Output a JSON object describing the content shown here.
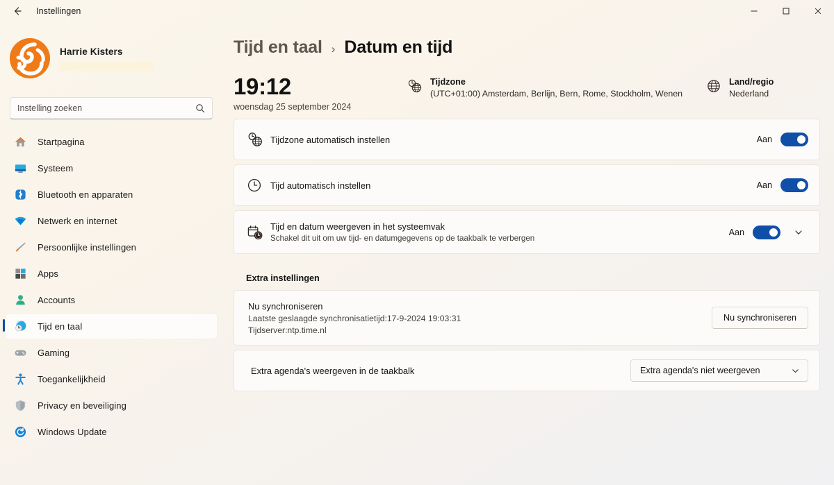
{
  "window": {
    "title": "Instellingen",
    "back_icon": "back-arrow-icon",
    "minimize_label": "–",
    "maximize_label": "□",
    "close_label": "✕"
  },
  "sidebar": {
    "profile": {
      "name": "Harrie Kisters",
      "email_redacted": true
    },
    "search": {
      "placeholder": "Instelling zoeken",
      "value": "",
      "icon": "search-icon"
    },
    "items": [
      {
        "label": "Startpagina",
        "icon": "home-icon",
        "selected": false
      },
      {
        "label": "Systeem",
        "icon": "monitor-icon",
        "selected": false
      },
      {
        "label": "Bluetooth en apparaten",
        "icon": "bluetooth-icon",
        "selected": false
      },
      {
        "label": "Netwerk en internet",
        "icon": "wifi-icon",
        "selected": false
      },
      {
        "label": "Persoonlijke instellingen",
        "icon": "paintbrush-icon",
        "selected": false
      },
      {
        "label": "Apps",
        "icon": "apps-icon",
        "selected": false
      },
      {
        "label": "Accounts",
        "icon": "person-icon",
        "selected": false
      },
      {
        "label": "Tijd en taal",
        "icon": "clock-globe-icon",
        "selected": true
      },
      {
        "label": "Gaming",
        "icon": "gamepad-icon",
        "selected": false
      },
      {
        "label": "Toegankelijkheid",
        "icon": "accessibility-icon",
        "selected": false
      },
      {
        "label": "Privacy en beveiliging",
        "icon": "shield-icon",
        "selected": false
      },
      {
        "label": "Windows Update",
        "icon": "update-icon",
        "selected": false
      }
    ]
  },
  "main": {
    "breadcrumb": {
      "parent": "Tijd en taal",
      "separator": "›",
      "current": "Datum en tijd"
    },
    "summary": {
      "time": "19:12",
      "date": "woensdag 25 september 2024",
      "timezone": {
        "icon": "clock-globe-icon",
        "title": "Tijdzone",
        "value": "(UTC+01:00) Amsterdam, Berlijn, Bern, Rome, Stockholm, Wenen"
      },
      "region": {
        "icon": "globe-icon",
        "title": "Land/regio",
        "value": "Nederland"
      }
    },
    "settings_cards": [
      {
        "icon": "clock-globe-icon",
        "title": "Tijdzone automatisch instellen",
        "subtitle": "",
        "toggle_state": "Aan",
        "toggle_on": true,
        "expandable": false
      },
      {
        "icon": "clock-icon",
        "title": "Tijd automatisch instellen",
        "subtitle": "",
        "toggle_state": "Aan",
        "toggle_on": true,
        "expandable": false
      },
      {
        "icon": "calendar-clock-icon",
        "title": "Tijd en datum weergeven in het systeemvak",
        "subtitle": "Schakel dit uit om uw tijd- en datumgegevens op de taakbalk te verbergen",
        "toggle_state": "Aan",
        "toggle_on": true,
        "expandable": true,
        "expand_icon": "chevron-down-icon"
      }
    ],
    "extra_section": {
      "heading": "Extra instellingen",
      "sync": {
        "title": "Nu synchroniseren",
        "last_sync": "Laatste geslaagde synchronisatietijd:17-9-2024 19:03:31",
        "server": "Tijdserver:ntp.time.nl",
        "button_label": "Nu synchroniseren"
      },
      "agenda": {
        "label": "Extra agenda's weergeven in de taakbalk",
        "selected_option": "Extra agenda's niet weergeven",
        "dropdown_icon": "chevron-down-icon"
      }
    }
  },
  "colors": {
    "accent": "#0f4fa8",
    "brand_orange": "#ef7a18",
    "card_bg": "#fcfbf9",
    "page_bg": "#faf5ec"
  }
}
